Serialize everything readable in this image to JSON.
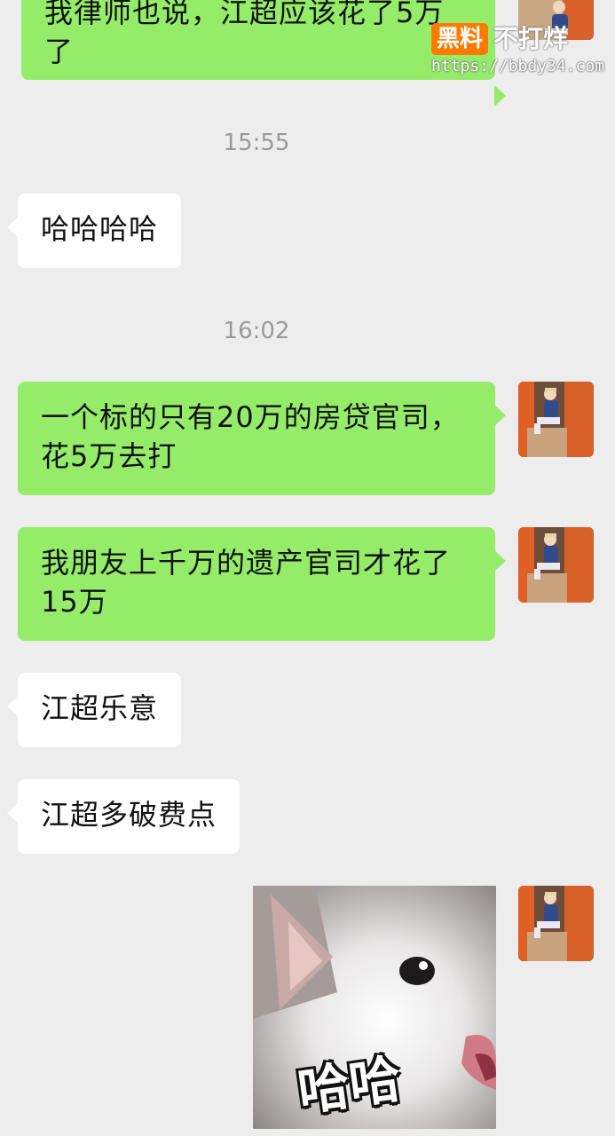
{
  "watermark": {
    "badge": "黑料",
    "brand": "不打烊",
    "url": "https://bbdy34.com"
  },
  "messages": [
    {
      "side": "right",
      "text": "我律师也说，江超应该花了5万了"
    },
    {
      "type": "time",
      "text": "15:55"
    },
    {
      "side": "left",
      "text": "哈哈哈哈"
    },
    {
      "type": "time",
      "text": "16:02"
    },
    {
      "side": "right",
      "text": "一个标的只有20万的房贷官司，花5万去打"
    },
    {
      "side": "right",
      "text": "我朋友上千万的遗产官司才花了15万"
    },
    {
      "side": "left",
      "text": "江超乐意"
    },
    {
      "side": "left",
      "text": "江超多破费点"
    },
    {
      "side": "right",
      "type": "sticker",
      "caption": "哈哈"
    }
  ]
}
